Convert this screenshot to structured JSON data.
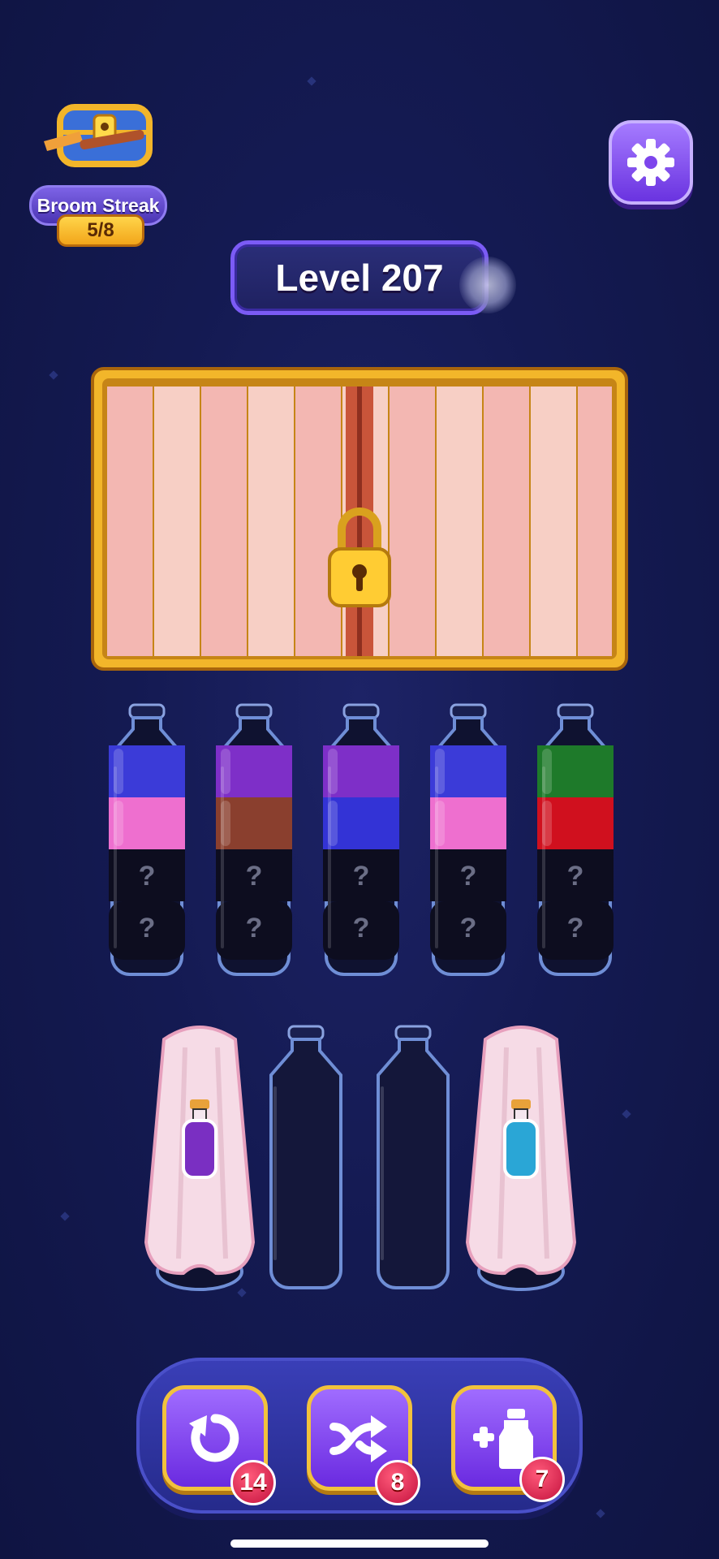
{
  "streak": {
    "title": "Broom Streak",
    "progress": "5/8"
  },
  "level": {
    "label": "Level 207"
  },
  "crate": {
    "locked": true
  },
  "top_tubes": [
    {
      "layers": [
        "#3b3bd8",
        "#ee6fcf",
        "unknown",
        "unknown"
      ]
    },
    {
      "layers": [
        "#7e2fc8",
        "#8a3f2e",
        "unknown",
        "unknown"
      ]
    },
    {
      "layers": [
        "#7e2fc8",
        "#3333d6",
        "unknown",
        "unknown"
      ]
    },
    {
      "layers": [
        "#3b3bd8",
        "#ee6fcf",
        "unknown",
        "unknown"
      ]
    },
    {
      "layers": [
        "#1e7a2a",
        "#d0101e",
        "unknown",
        "unknown"
      ]
    }
  ],
  "hidden_marker": "?",
  "bottom_tubes": [
    {
      "state": "covered",
      "icon_color": "#7a2fc2"
    },
    {
      "state": "empty"
    },
    {
      "state": "empty"
    },
    {
      "state": "covered",
      "icon_color": "#2aa6d6"
    }
  ],
  "boosters": {
    "undo": {
      "count": "14"
    },
    "shuffle": {
      "count": "8"
    },
    "add_tube": {
      "count": "7"
    }
  }
}
